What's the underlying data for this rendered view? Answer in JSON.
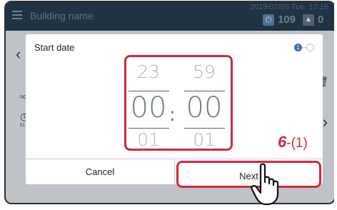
{
  "topbar": {
    "building_name": "Building name",
    "datetime": "2019/07/09 Tue. 17:16",
    "count_a": "109",
    "count_b": "0"
  },
  "dialog": {
    "title": "Start date",
    "step_current": "1",
    "picker": {
      "hour_prev": "23",
      "hour": "00",
      "hour_next": "01",
      "separator": ":",
      "minute_prev": "59",
      "minute": "00",
      "minute_next": "01"
    },
    "cancel_label": "Cancel",
    "next_label": "Next"
  },
  "annotation": {
    "step_num": "6",
    "step_sub": "-(1)"
  },
  "background": {
    "no_label": "NO.",
    "id_label": "01"
  },
  "colors": {
    "highlight": "#d2293e",
    "topbar": "#1f3345",
    "accent": "#3e6ea3"
  }
}
